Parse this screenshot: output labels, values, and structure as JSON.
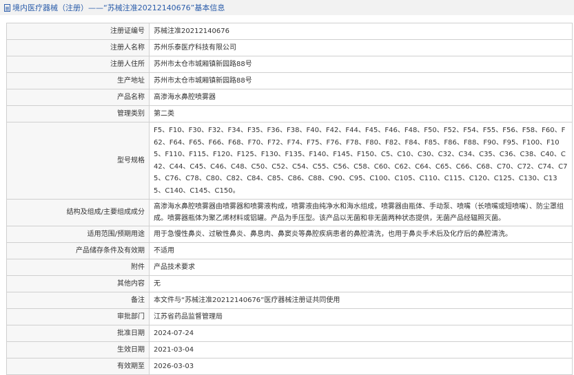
{
  "header": {
    "title": "境内医疗器械（注册）——“苏械注准20212140676”基本信息"
  },
  "rows": [
    {
      "label": "注册证编号",
      "value": "苏械注准20212140676"
    },
    {
      "label": "注册人名称",
      "value": "苏州乐泰医疗科技有限公司"
    },
    {
      "label": "注册人住所",
      "value": "苏州市太仓市城厢镇新园路88号"
    },
    {
      "label": "生产地址",
      "value": "苏州市太仓市城厢镇新园路88号"
    },
    {
      "label": "产品名称",
      "value": "高渗海水鼻腔喷雾器"
    },
    {
      "label": "管理类别",
      "value": "第二类"
    },
    {
      "label": "型号规格",
      "value": "F5、F10、F30、F32、F34、F35、F36、F38、F40、F42、F44、F45、F46、F48、F50、F52、F54、F55、F56、F58、F60、F62、F64、F65、F66、F68、F70、F72、F74、F75、F76、F78、F80、F82、F84、F85、F86、F88、F90、F95、F100、F105、F110、F115、F120、F125、F130、F135、F140、F145、F150、C5、C10、C30、C32、C34、C35、C36、C38、C40、C42、C44、C45、C46、C48、C50、C52、C54、C55、C56、C58、C60、C62、C64、C65、C66、C68、C70、C72、C74、C75、C76、C78、C80、C82、C84、C85、C86、C88、C90、C95、C100、C105、C110、C115、C120、C125、C130、C135、C140、C145、C150。"
    },
    {
      "label": "结构及组成/主要组成成分",
      "value": "高渗海水鼻腔喷雾器由喷雾器和喷雾液构成，喷雾液由纯净水和海水组成，喷雾器由瓶体、手动泵、喷嘴（长喷嘴或短喷嘴）、防尘罩组成。喷雾器瓶体为聚乙烯材料或铝罐。产品为手压型。该产品以无菌和非无菌两种状态提供，无菌产品经辐照灭菌。"
    },
    {
      "label": "适用范围/预期用途",
      "value": "用于急慢性鼻炎、过敏性鼻炎、鼻息肉、鼻窦炎等鼻腔疾病患者的鼻腔清洗，也用于鼻炎手术后及化疗后的鼻腔清洗。"
    },
    {
      "label": "产品储存条件及有效期",
      "value": "不适用"
    },
    {
      "label": "附件",
      "value": "产品技术要求"
    },
    {
      "label": "其他内容",
      "value": "无"
    },
    {
      "label": "备注",
      "value": "本文件与“苏械注准20212140676”医疗器械注册证共同使用"
    },
    {
      "label": "审批部门",
      "value": "江苏省药品监督管理局"
    },
    {
      "label": "批准日期",
      "value": "2024-07-24"
    },
    {
      "label": "生效日期",
      "value": "2021-03-04"
    },
    {
      "label": "有效期至",
      "value": "2026-03-03"
    }
  ]
}
